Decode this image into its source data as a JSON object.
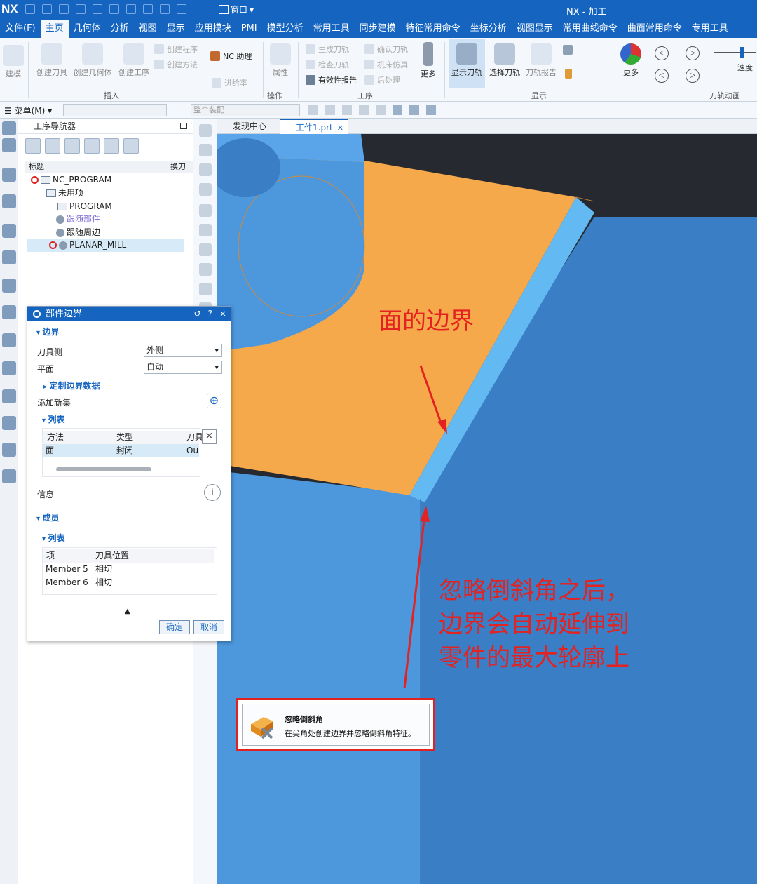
{
  "app": {
    "logo": "NX",
    "title": "NX - 加工",
    "window_menu": "窗口"
  },
  "menu": [
    "文件(F)",
    "主页",
    "几何体",
    "分析",
    "视图",
    "显示",
    "应用模块",
    "PMI",
    "模型分析",
    "常用工具",
    "同步建模",
    "特征常用命令",
    "坐标分析",
    "视图显示",
    "常用曲线命令",
    "曲面常用命令",
    "专用工具"
  ],
  "menu_active_index": 1,
  "ribbon": {
    "buttons": [
      "建模",
      "创建刀具",
      "创建几何体",
      "创建工序",
      "创建程序",
      "创建方法",
      "NC 助理",
      "属性",
      "进给率",
      "生成刀轨",
      "检查刀轨",
      "有效性报告",
      "确认刀轨",
      "机床仿真",
      "后处理",
      "更多",
      "显示刀轨",
      "选择刀轨",
      "刀轨报告",
      "更多",
      "速度"
    ],
    "groups": [
      "插入",
      "操作",
      "工序",
      "显示",
      "刀轨动画"
    ]
  },
  "toolbar2": {
    "menu_label": "菜单(M)",
    "assembly_placeholder": "整个装配"
  },
  "navigator": {
    "title": "工序导航器",
    "col_title": "标题",
    "col_change": "换刀",
    "tree": [
      {
        "label": "NC_PROGRAM",
        "status": "none"
      },
      {
        "label": "未用项",
        "status": "folder"
      },
      {
        "label": "PROGRAM",
        "status": "folder"
      },
      {
        "label": "跟随部件",
        "status": "gear"
      },
      {
        "label": "跟随周边",
        "status": "gear"
      },
      {
        "label": "PLANAR_MILL",
        "status": "none"
      }
    ]
  },
  "tabs": [
    {
      "label": "发现中心",
      "active": false
    },
    {
      "label": "工件1.prt",
      "active": true
    }
  ],
  "dialog": {
    "title": "部件边界",
    "title_controls": [
      "↺",
      "?",
      "×"
    ],
    "section_boundary": "边界",
    "tool_side_label": "刀具侧",
    "tool_side_value": "外侧",
    "plane_label": "平面",
    "plane_value": "自动",
    "custom_data": "定制边界数据",
    "add_new_set": "添加新集",
    "list_label": "列表",
    "list_headers": [
      "方法",
      "类型",
      "刀具"
    ],
    "list_row": [
      "面",
      "封闭",
      "Ou"
    ],
    "info": "信息",
    "members_section": "成员",
    "members_list": "列表",
    "member_headers": [
      "项",
      "刀具位置"
    ],
    "members": [
      {
        "item": "Member 5",
        "pos": "相切"
      },
      {
        "item": "Member 6",
        "pos": "相切"
      }
    ],
    "ok": "确定",
    "cancel": "取消"
  },
  "annotations": {
    "face_boundary": "面的边界",
    "note_lines": [
      "忽略倒斜角之后，",
      "边界会自动延伸到",
      "零件的最大轮廓上"
    ]
  },
  "tooltip": {
    "title": "忽略倒斜角",
    "desc": "在尖角处创建边界并忽略倒斜角特征。"
  },
  "colors": {
    "accent": "#1565c0",
    "face_top": "#f6a94a",
    "part_blue": "#4d97dd",
    "chamfer": "#63b9f2",
    "annotation": "#e32222",
    "viewport_bg": "#262a30"
  }
}
